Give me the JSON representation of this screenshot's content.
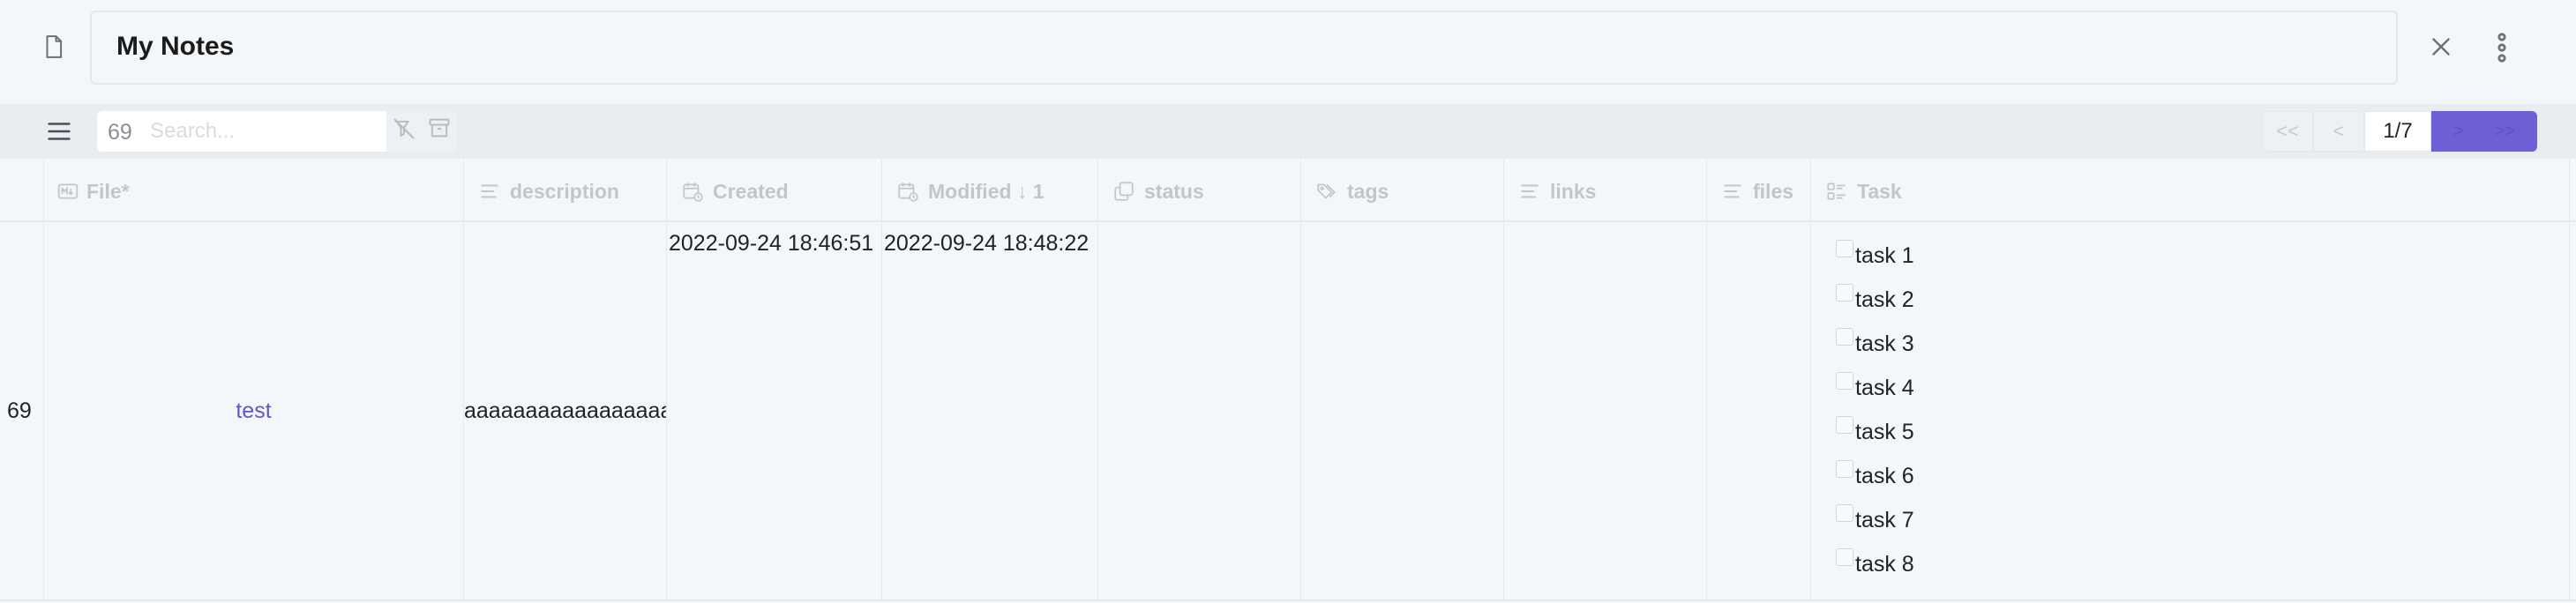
{
  "title": "My Notes",
  "toolbar": {
    "count": "69",
    "search_placeholder": "Search...",
    "pager": {
      "first": "<<",
      "prev": "<",
      "current": "1/7",
      "next": ">",
      "last": ">>"
    }
  },
  "columns": [
    {
      "label": "File*",
      "icon": "markdown-icon"
    },
    {
      "label": "description",
      "icon": "text-lines-icon"
    },
    {
      "label": "Created",
      "icon": "calendar-clock-icon"
    },
    {
      "label": "Modified ↓ 1",
      "icon": "calendar-clock-icon"
    },
    {
      "label": "status",
      "icon": "copy-icon"
    },
    {
      "label": "tags",
      "icon": "tags-icon"
    },
    {
      "label": "links",
      "icon": "text-lines-icon"
    },
    {
      "label": "files",
      "icon": "text-lines-icon"
    },
    {
      "label": "Task",
      "icon": "checklist-icon"
    }
  ],
  "rows": [
    {
      "index": "69",
      "file": "test",
      "description": "aaaaaaaaaaaaaaaaaaaaaaaa",
      "created": "2022-09-24 18:46:51",
      "modified": "2022-09-24 18:48:22",
      "status": "",
      "tags": "",
      "links": "",
      "files": "",
      "tasks": [
        {
          "label": "task 1",
          "checked": false
        },
        {
          "label": "task 2",
          "checked": false
        },
        {
          "label": "task 3",
          "checked": false
        },
        {
          "label": "task 4",
          "checked": false
        },
        {
          "label": "task 5",
          "checked": false
        },
        {
          "label": "task 6",
          "checked": false
        },
        {
          "label": "task 7",
          "checked": false
        },
        {
          "label": "task 8",
          "checked": false
        }
      ]
    }
  ],
  "colors": {
    "accent": "#6d5fd5",
    "link": "#6356c9",
    "background": "#f4f7fa",
    "toolbar": "#e9edf1"
  }
}
